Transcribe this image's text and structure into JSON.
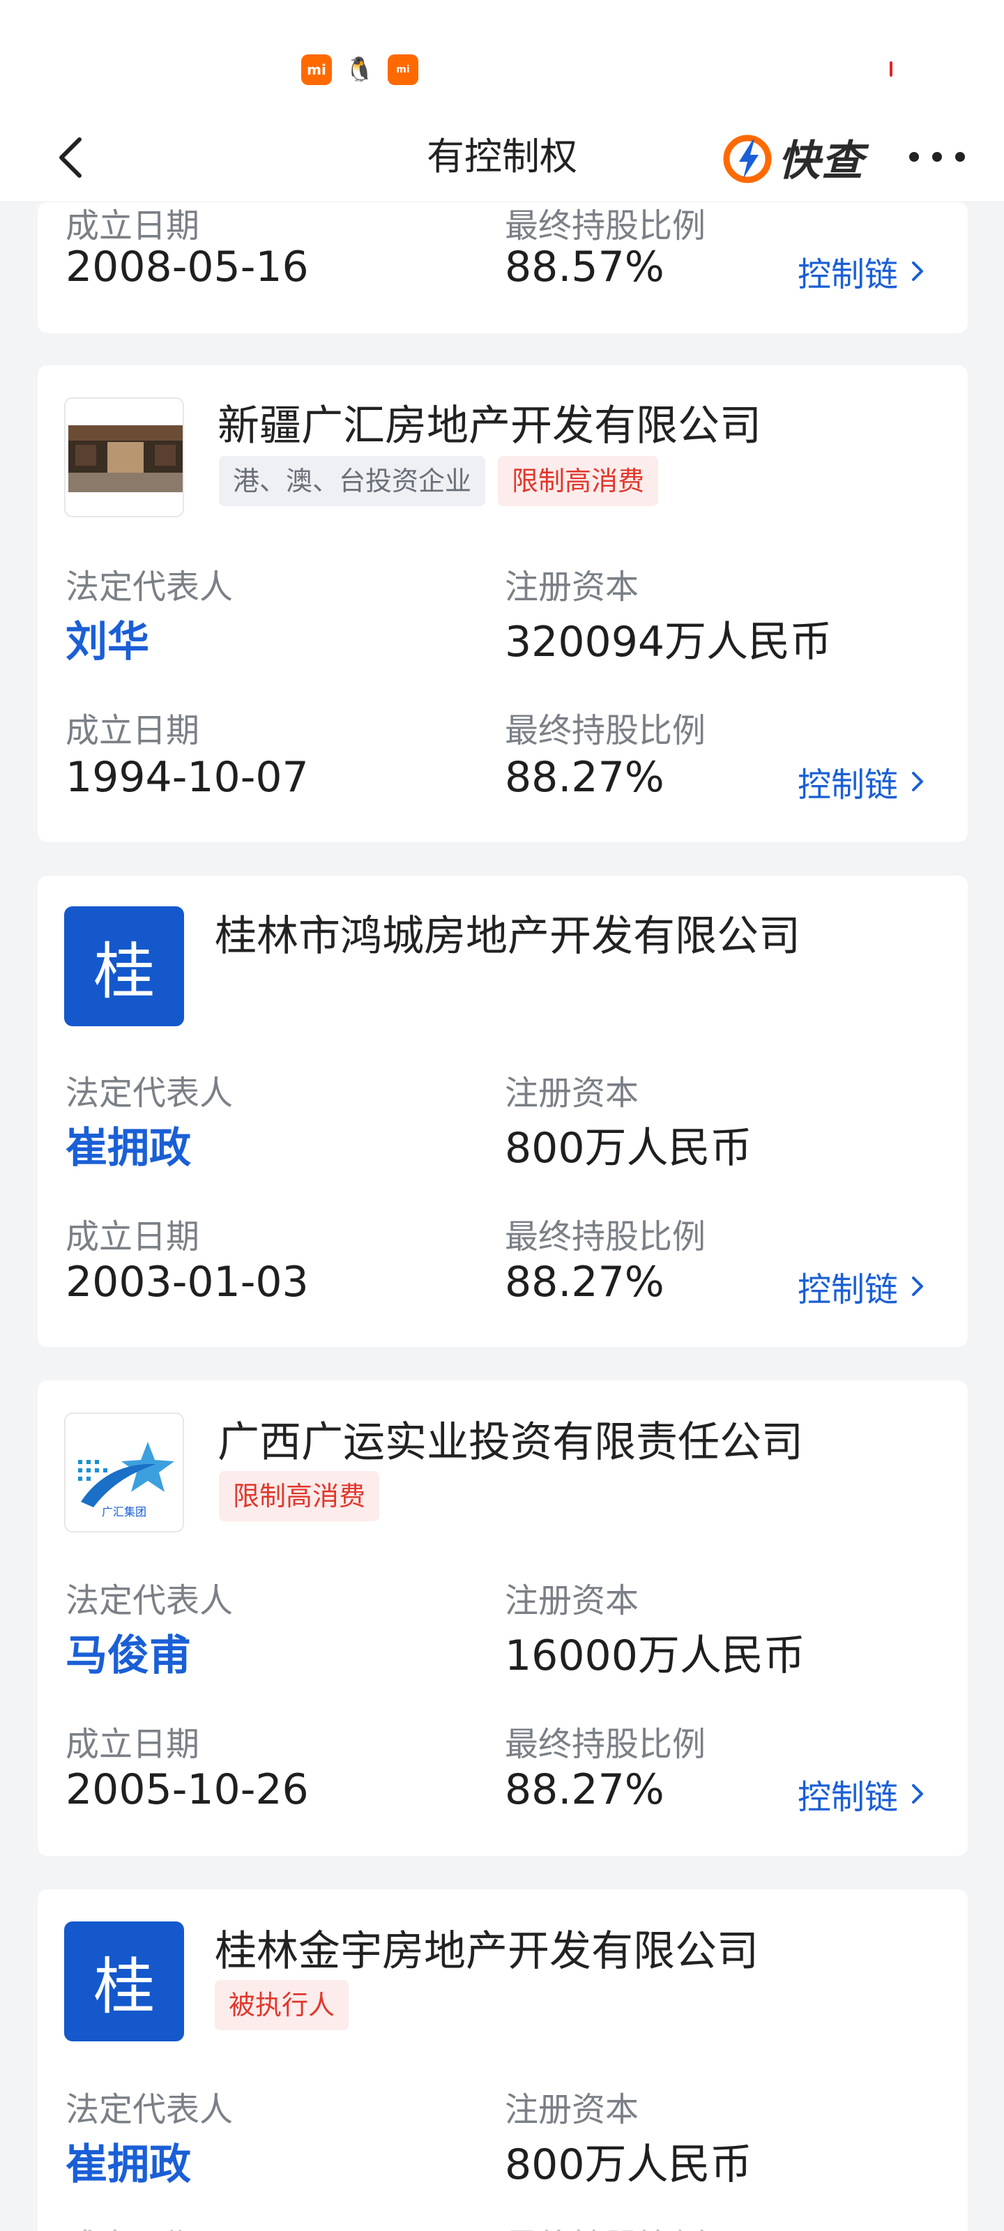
{
  "status_bar": {
    "icons": [
      "mi-app-icon",
      "qq-icon",
      "mi-store-icon"
    ],
    "icon_labels": [
      "mi",
      "",
      "mi"
    ]
  },
  "header": {
    "title": "有控制权",
    "brand_name": "快查"
  },
  "field_labels": {
    "legal_rep": "法定代表人",
    "reg_capital": "注册资本",
    "founded": "成立日期",
    "ratio": "最终持股比例",
    "chain": "控制链"
  },
  "companies": [
    {
      "founded": "2008-05-16",
      "ratio": "88.57%"
    },
    {
      "name": "新疆广汇房地产开发有限公司",
      "logo": "building-photo",
      "tags": [
        "港、澳、台投资企业",
        "限制高消费"
      ],
      "legal_rep": "刘华",
      "reg_capital": "320094万人民币",
      "founded": "1994-10-07",
      "ratio": "88.27%"
    },
    {
      "name": "桂林市鸿城房地产开发有限公司",
      "logo_char": "桂",
      "tags": [],
      "legal_rep": "崔拥政",
      "reg_capital": "800万人民币",
      "founded": "2003-01-03",
      "ratio": "88.27%"
    },
    {
      "name": "广西广运实业投资有限责任公司",
      "logo": "guanghui-group-logo",
      "logo_text": "广汇集团",
      "tags": [
        "限制高消费"
      ],
      "legal_rep": "马俊甫",
      "reg_capital": "16000万人民币",
      "founded": "2005-10-26",
      "ratio": "88.27%"
    },
    {
      "name": "桂林金宇房地产开发有限公司",
      "logo_char": "桂",
      "tags": [
        "被执行人"
      ],
      "legal_rep": "崔拥政",
      "reg_capital": "800万人民币"
    }
  ],
  "colors": {
    "link_blue": "#1a5fd6",
    "logo_blue": "#1458cc",
    "tag_red": "#e0382c",
    "brand_orange": "#ff6a00"
  }
}
